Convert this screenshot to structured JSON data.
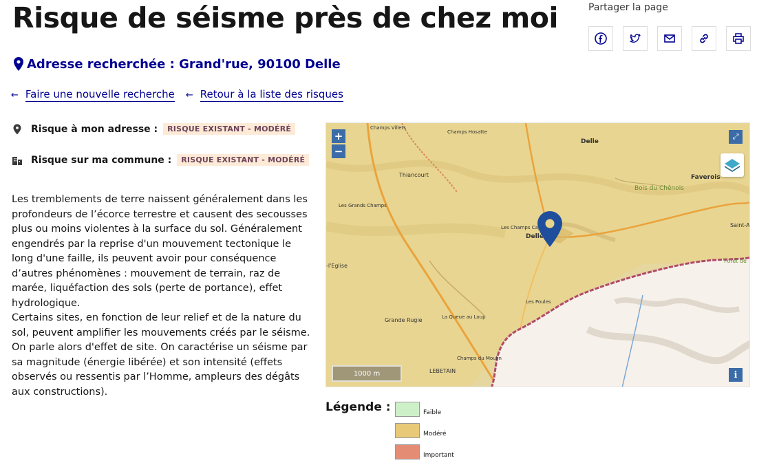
{
  "page": {
    "title": "Risque de séisme près de chez moi"
  },
  "share": {
    "label": "Partager la page",
    "buttons": [
      {
        "icon": "facebook-icon"
      },
      {
        "icon": "twitter-icon"
      },
      {
        "icon": "mail-icon"
      },
      {
        "icon": "link-icon"
      },
      {
        "icon": "print-icon"
      }
    ]
  },
  "address": {
    "text": "Adresse recherchée : Grand'rue, 90100 Delle"
  },
  "nav": {
    "new_search": "Faire une nouvelle recherche",
    "back_to_list": "Retour à la liste des risques"
  },
  "risks": {
    "address_label": "Risque à mon adresse :",
    "address_badge": "RISQUE EXISTANT - MODÉRÉ",
    "commune_label": "Risque sur ma commune :",
    "commune_badge": "RISQUE EXISTANT - MODÉRÉ"
  },
  "description": {
    "p1": "Les tremblements de terre naissent généralement dans les profondeurs de l’écorce terrestre et causent des secousses plus ou moins violentes à la surface du sol. Généralement engendrés par la reprise d'un mouvement tectonique le long d'une faille, ils peuvent avoir pour conséquence d’autres phénomènes : mouvement de terrain, raz de marée, liquéfaction des sols (perte de portance), effet hydrologique.",
    "p2": "Certains sites, en fonction de leur relief et de la nature du sol, peuvent amplifier les mouvements créés par le séisme. On parle alors d'effet de site. On caractérise un séisme par sa magnitude (énergie libérée) et son intensité (effets observés ou ressentis par l’Homme, ampleurs des dégâts aux constructions)."
  },
  "map": {
    "zoom_in": "+",
    "zoom_out": "−",
    "scale": "1000 m",
    "info": "i",
    "labels": {
      "delle": "Delle",
      "delle_center": "Delle",
      "faverois": "Faverois",
      "thiancourt": "Thiancourt",
      "bois_chenois": "Bois du Chênois",
      "lebetain": "LEBETAIN",
      "grande_rugie": "Grande Rugie",
      "champs_villets": "Champs Villets",
      "champs_hosatte": "Champs Hosatte",
      "les_grands_champs": "Les Grands Champs",
      "la_queue_au_loup": "La Queue au Loup",
      "les_champs_capucins": "Les Champs Capucins",
      "champs_du_moulin": "Champs du Moulin",
      "eglise": "-l'Eglise",
      "les_poules": "Les Poules",
      "saint_andre": "Saint-Andr",
      "foret": "Forêt de"
    }
  },
  "legend": {
    "title": "Légende :",
    "items": [
      {
        "label": "Faible",
        "color": "#cdf0c9"
      },
      {
        "label": "Modéré",
        "color": "#e8c978"
      },
      {
        "label": "Important",
        "color": "#e58c74"
      }
    ]
  },
  "colors": {
    "primary": "#000091",
    "badge_bg": "#fdead7",
    "badge_text": "#6e445a",
    "map_control": "#3c6ca8"
  }
}
